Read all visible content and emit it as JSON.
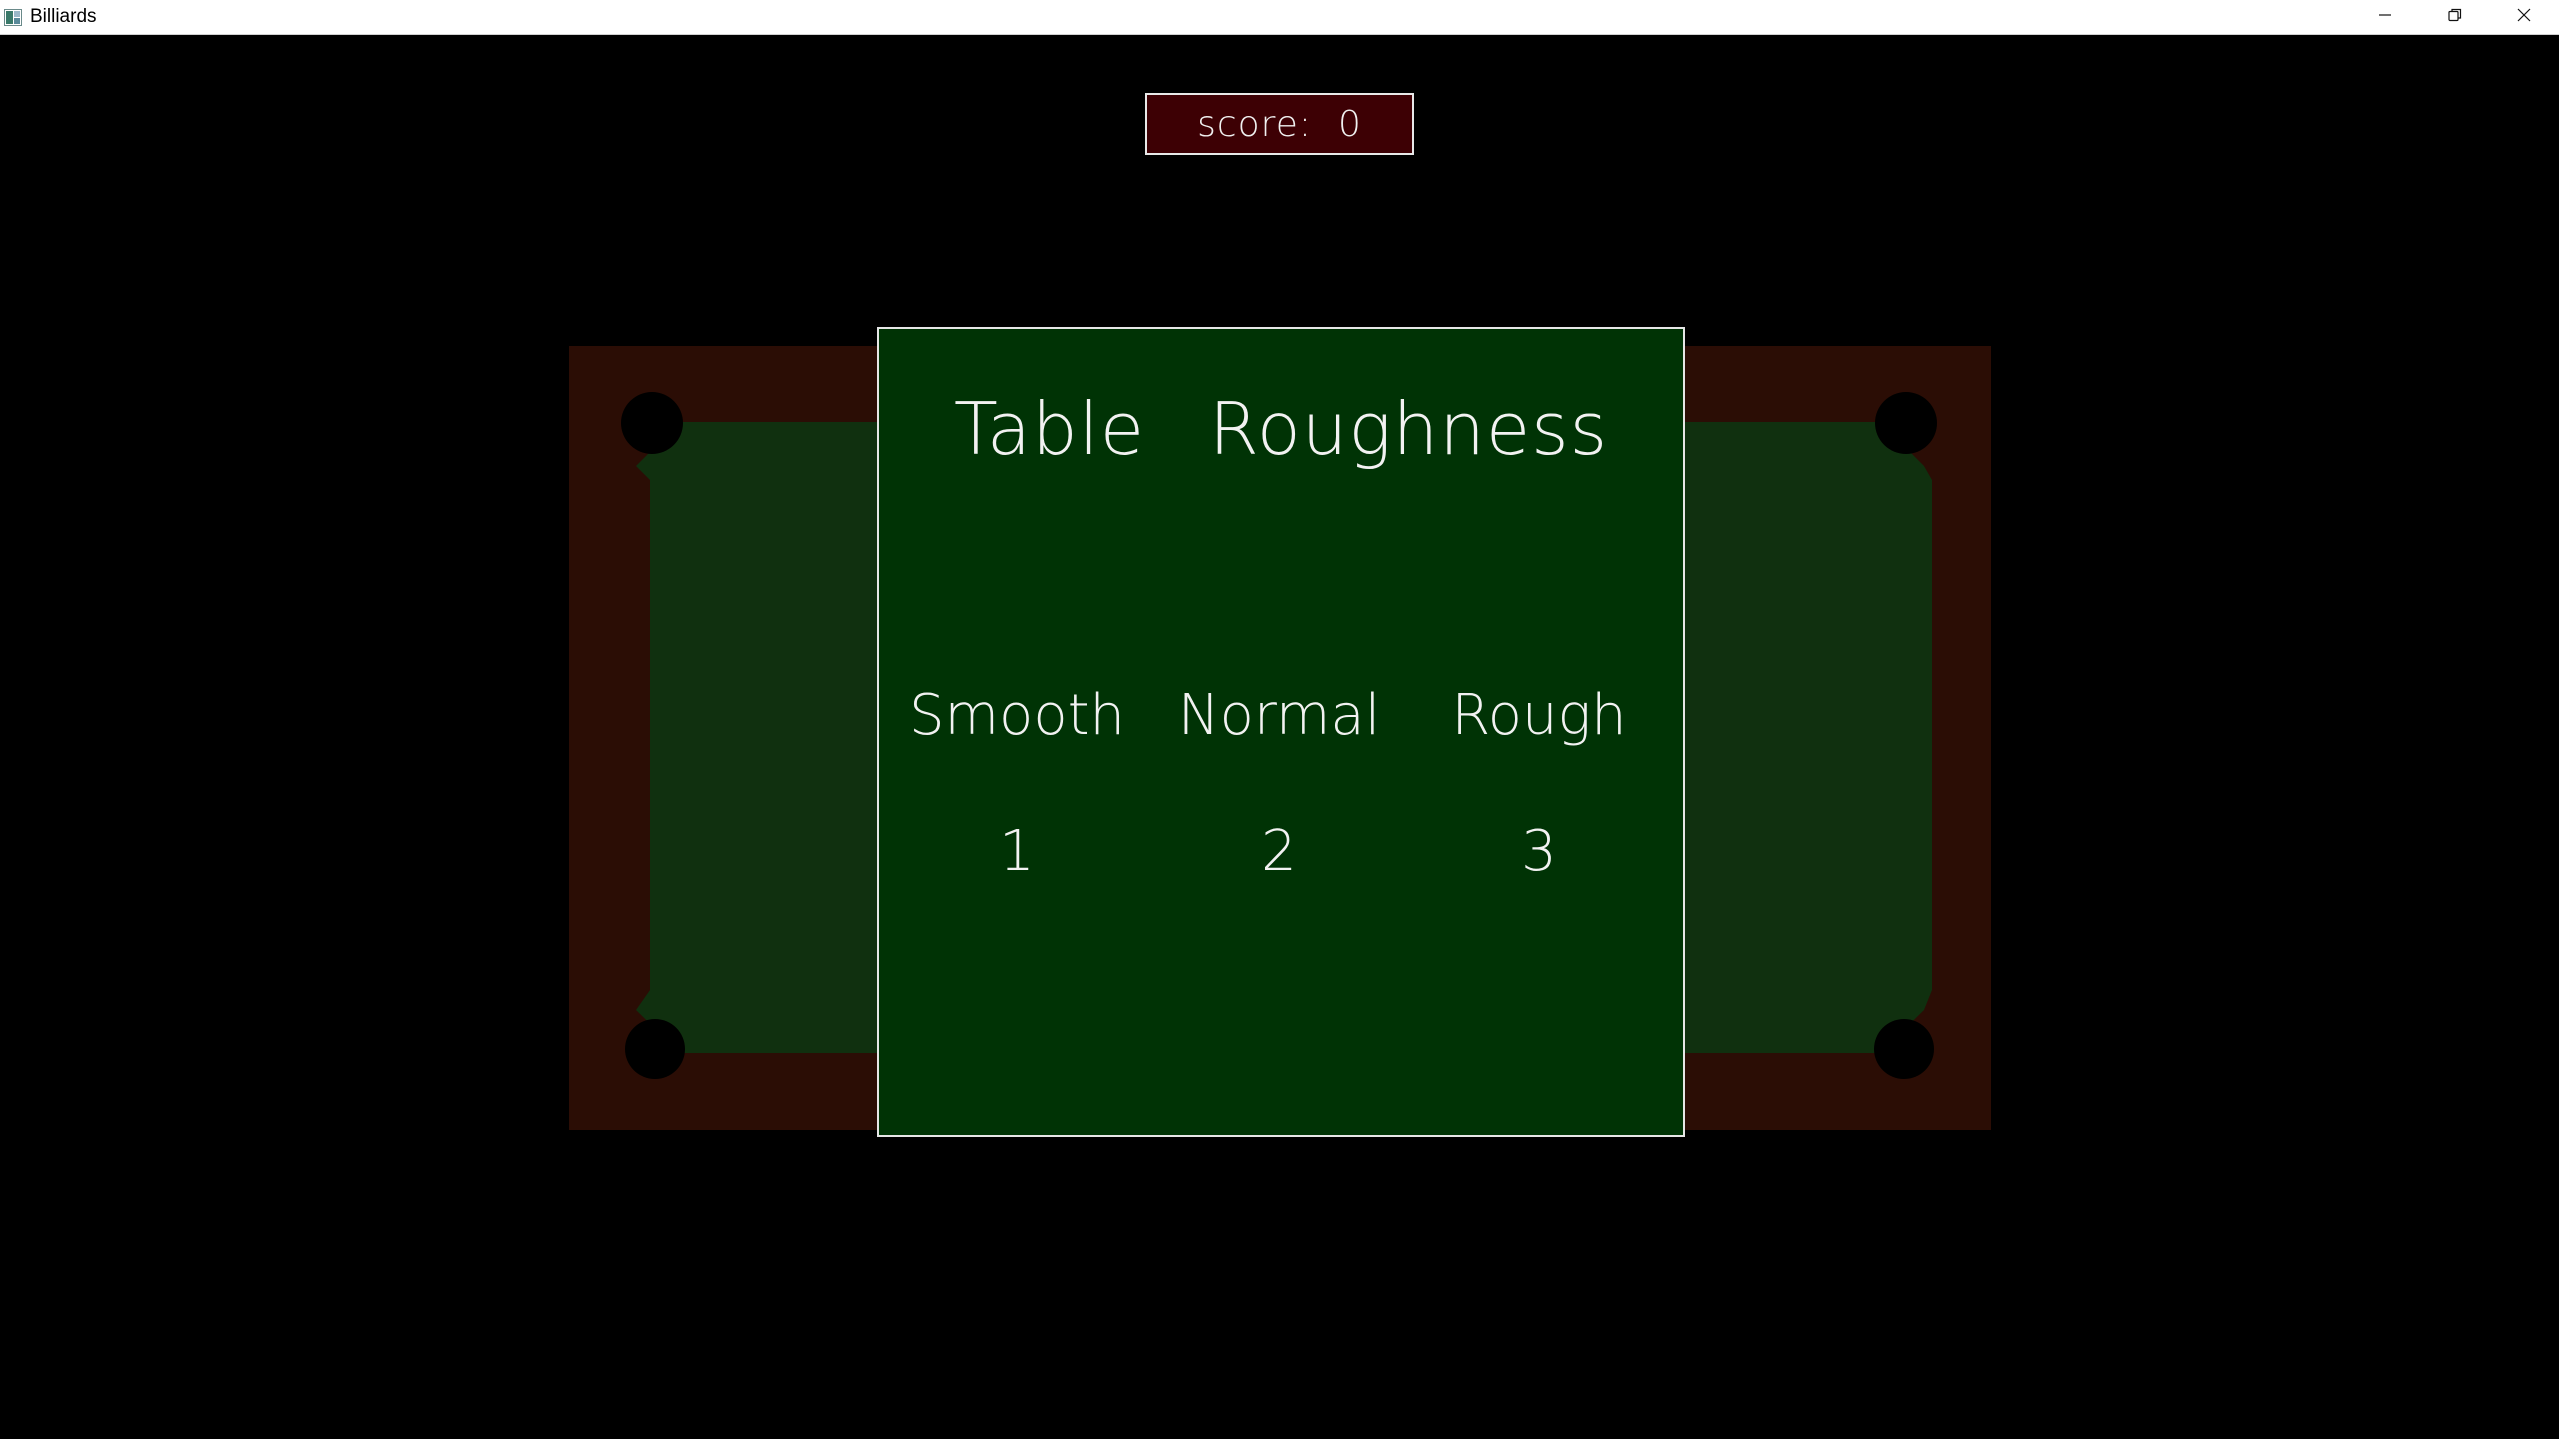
{
  "window": {
    "title": "Billiards",
    "controls": {
      "minimize_icon": "minimize-icon",
      "maximize_icon": "restore-icon",
      "close_icon": "close-icon"
    }
  },
  "score": {
    "label": "score:",
    "value": "0"
  },
  "dialog": {
    "title": "Table Roughness",
    "options": [
      {
        "label": "Smooth",
        "key": "1"
      },
      {
        "label": "Normal",
        "key": "2"
      },
      {
        "label": "Rough",
        "key": "3"
      }
    ]
  },
  "colors": {
    "background": "#000000",
    "table_rail": "#2b0d05",
    "table_felt": "#10300f",
    "pocket": "#000000",
    "dialog_bg": "#003305",
    "score_bg": "#3d0004",
    "text": "#f2f2f2"
  }
}
